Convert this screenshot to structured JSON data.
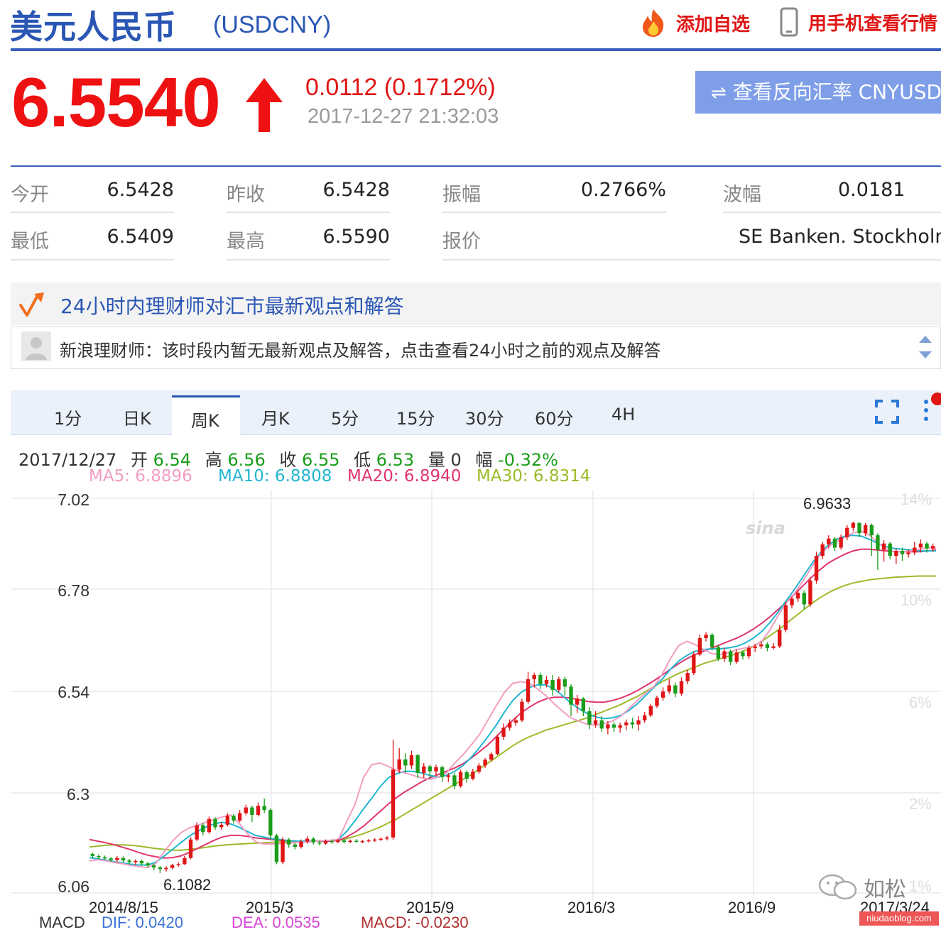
{
  "header": {
    "name_cn": "美元人民币",
    "symbol": "(USDCNY)",
    "add_watch": "添加自选",
    "mobile_view": "用手机查看行情"
  },
  "quote": {
    "price": "6.5540",
    "change": "0.0112 (0.1712%)",
    "timestamp": "2017-12-27 21:32:03",
    "reverse_button": "查看反向汇率 CNYUSD"
  },
  "stats": [
    {
      "label": "今开",
      "value": "6.5428"
    },
    {
      "label": "昨收",
      "value": "6.5428"
    },
    {
      "label": "振幅",
      "value": "0.2766%"
    },
    {
      "label": "波幅",
      "value": "0.0181"
    },
    {
      "label": "最低",
      "value": "6.5409"
    },
    {
      "label": "最高",
      "value": "6.5590"
    },
    {
      "label": "报价",
      "value": "SE Banken. Stockholm"
    }
  ],
  "advisor": {
    "title": "24小时内理财师对汇市最新观点和解答",
    "note": "新浪理财师：该时段内暂无最新观点及解答，点击查看24小时之前的观点及解答"
  },
  "tabs": [
    "1分",
    "日K",
    "周K",
    "月K",
    "5分",
    "15分",
    "30分",
    "60分",
    "4H"
  ],
  "active_tab": "周K",
  "ohlc": {
    "date": "2017/12/27",
    "open_label": "开",
    "open": "6.54",
    "high_label": "高",
    "high": "6.56",
    "close_label": "收",
    "close": "6.55",
    "low_label": "低",
    "low": "6.53",
    "vol_label": "量",
    "vol": "0",
    "amp_label": "幅",
    "amp": "-0.32%"
  },
  "ma": {
    "ma5": "MA5: 6.8896",
    "ma10": "MA10: 6.8808",
    "ma20": "MA20: 6.8940",
    "ma30": "MA30: 6.8314"
  },
  "macd": {
    "label": "MACD",
    "dif": "DIF: 0.0420",
    "dea": "DEA: 0.0535",
    "macd": "MACD: -0.0230"
  },
  "watermark": "如松",
  "site": "niudaoblog.com",
  "colors": {
    "up": "#e01515",
    "down": "#1a9d1a",
    "ma5": "#f19ec2",
    "ma10": "#21b6d0",
    "ma20": "#e0356e",
    "ma30": "#9bbb2a"
  },
  "chart_data": {
    "type": "candlestick",
    "y_ticks": [
      "7.02",
      "6.78",
      "6.54",
      "6.3",
      "6.06"
    ],
    "y_ticks_right": [
      "14%",
      "10%",
      "6%",
      "2%",
      "1%"
    ],
    "ylim": [
      6.06,
      7.02
    ],
    "x_ticks": [
      "2014/8/15",
      "2015/3",
      "2015/9",
      "2016/3",
      "2016/9",
      "2017/3/24"
    ],
    "annotations": {
      "max": "6.9633",
      "min": "6.1082"
    },
    "candles": [
      [
        6.155,
        6.15,
        6.158,
        6.145
      ],
      [
        6.15,
        6.147,
        6.154,
        6.142
      ],
      [
        6.147,
        6.144,
        6.151,
        6.14
      ],
      [
        6.144,
        6.14,
        6.148,
        6.136
      ],
      [
        6.14,
        6.145,
        6.15,
        6.135
      ],
      [
        6.145,
        6.139,
        6.149,
        6.134
      ],
      [
        6.139,
        6.135,
        6.143,
        6.13
      ],
      [
        6.135,
        6.138,
        6.142,
        6.128
      ],
      [
        6.138,
        6.132,
        6.141,
        6.126
      ],
      [
        6.132,
        6.127,
        6.136,
        6.121
      ],
      [
        6.127,
        6.122,
        6.131,
        6.115
      ],
      [
        6.122,
        6.118,
        6.126,
        6.108
      ],
      [
        6.118,
        6.121,
        6.125,
        6.112
      ],
      [
        6.121,
        6.128,
        6.131,
        6.118
      ],
      [
        6.128,
        6.13,
        6.134,
        6.124
      ],
      [
        6.13,
        6.145,
        6.15,
        6.128
      ],
      [
        6.145,
        6.19,
        6.196,
        6.142
      ],
      [
        6.19,
        6.225,
        6.232,
        6.186
      ],
      [
        6.225,
        6.208,
        6.23,
        6.2
      ],
      [
        6.208,
        6.24,
        6.246,
        6.204
      ],
      [
        6.24,
        6.22,
        6.244,
        6.214
      ],
      [
        6.22,
        6.226,
        6.232,
        6.214
      ],
      [
        6.226,
        6.248,
        6.254,
        6.222
      ],
      [
        6.248,
        6.236,
        6.252,
        6.228
      ],
      [
        6.236,
        6.254,
        6.262,
        6.232
      ],
      [
        6.254,
        6.268,
        6.275,
        6.249
      ],
      [
        6.268,
        6.25,
        6.272,
        6.232
      ],
      [
        6.25,
        6.272,
        6.28,
        6.246
      ],
      [
        6.272,
        6.262,
        6.29,
        6.254
      ],
      [
        6.262,
        6.2,
        6.266,
        6.19
      ],
      [
        6.2,
        6.135,
        6.204,
        6.13
      ],
      [
        6.135,
        6.19,
        6.196,
        6.13
      ],
      [
        6.19,
        6.178,
        6.194,
        6.17
      ],
      [
        6.178,
        6.172,
        6.182,
        6.166
      ],
      [
        6.172,
        6.185,
        6.19,
        6.168
      ],
      [
        6.185,
        6.192,
        6.198,
        6.18
      ],
      [
        6.192,
        6.183,
        6.196,
        6.178
      ],
      [
        6.183,
        6.18,
        6.187,
        6.176
      ],
      [
        6.18,
        6.186,
        6.19,
        6.177
      ],
      [
        6.186,
        6.184,
        6.19,
        6.18
      ],
      [
        6.184,
        6.188,
        6.192,
        6.181
      ],
      [
        6.188,
        6.184,
        6.191,
        6.18
      ],
      [
        6.184,
        6.187,
        6.19,
        6.181
      ],
      [
        6.187,
        6.185,
        6.191,
        6.182
      ],
      [
        6.185,
        6.186,
        6.189,
        6.181
      ],
      [
        6.186,
        6.188,
        6.191,
        6.183
      ],
      [
        6.188,
        6.19,
        6.193,
        6.184
      ],
      [
        6.19,
        6.192,
        6.195,
        6.186
      ],
      [
        6.192,
        6.195,
        6.198,
        6.188
      ],
      [
        6.195,
        6.36,
        6.433,
        6.19
      ],
      [
        6.36,
        6.385,
        6.412,
        6.352
      ],
      [
        6.385,
        6.37,
        6.4,
        6.352
      ],
      [
        6.37,
        6.395,
        6.406,
        6.362
      ],
      [
        6.395,
        6.352,
        6.398,
        6.34
      ],
      [
        6.352,
        6.368,
        6.376,
        6.34
      ],
      [
        6.368,
        6.356,
        6.372,
        6.338
      ],
      [
        6.356,
        6.366,
        6.372,
        6.346
      ],
      [
        6.366,
        6.342,
        6.37,
        6.33
      ],
      [
        6.342,
        6.346,
        6.352,
        6.33
      ],
      [
        6.346,
        6.32,
        6.352,
        6.312
      ],
      [
        6.32,
        6.354,
        6.36,
        6.316
      ],
      [
        6.354,
        6.338,
        6.358,
        6.328
      ],
      [
        6.338,
        6.355,
        6.362,
        6.334
      ],
      [
        6.355,
        6.37,
        6.376,
        6.35
      ],
      [
        6.37,
        6.384,
        6.388,
        6.364
      ],
      [
        6.384,
        6.398,
        6.402,
        6.38
      ],
      [
        6.398,
        6.44,
        6.446,
        6.395
      ],
      [
        6.44,
        6.462,
        6.472,
        6.432
      ],
      [
        6.462,
        6.474,
        6.482,
        6.455
      ],
      [
        6.474,
        6.48,
        6.488,
        6.466
      ],
      [
        6.48,
        6.525,
        6.532,
        6.476
      ],
      [
        6.525,
        6.58,
        6.598,
        6.52
      ],
      [
        6.58,
        6.59,
        6.596,
        6.56
      ],
      [
        6.59,
        6.568,
        6.596,
        6.556
      ],
      [
        6.568,
        6.578,
        6.588,
        6.56
      ],
      [
        6.578,
        6.554,
        6.59,
        6.54
      ],
      [
        6.554,
        6.58,
        6.586,
        6.548
      ],
      [
        6.58,
        6.562,
        6.586,
        6.54
      ],
      [
        6.562,
        6.518,
        6.568,
        6.49
      ],
      [
        6.518,
        6.533,
        6.542,
        6.498
      ],
      [
        6.533,
        6.502,
        6.536,
        6.49
      ],
      [
        6.502,
        6.47,
        6.512,
        6.458
      ],
      [
        6.47,
        6.48,
        6.502,
        6.462
      ],
      [
        6.48,
        6.46,
        6.49,
        6.452
      ],
      [
        6.46,
        6.47,
        6.478,
        6.446
      ],
      [
        6.47,
        6.462,
        6.476,
        6.452
      ],
      [
        6.462,
        6.468,
        6.474,
        6.45
      ],
      [
        6.468,
        6.475,
        6.482,
        6.456
      ],
      [
        6.475,
        6.47,
        6.486,
        6.46
      ],
      [
        6.47,
        6.48,
        6.49,
        6.455
      ],
      [
        6.48,
        6.492,
        6.5,
        6.474
      ],
      [
        6.492,
        6.515,
        6.52,
        6.488
      ],
      [
        6.515,
        6.535,
        6.54,
        6.51
      ],
      [
        6.535,
        6.55,
        6.56,
        6.528
      ],
      [
        6.55,
        6.565,
        6.58,
        6.544
      ],
      [
        6.565,
        6.545,
        6.572,
        6.536
      ],
      [
        6.545,
        6.575,
        6.584,
        6.54
      ],
      [
        6.575,
        6.595,
        6.602,
        6.568
      ],
      [
        6.595,
        6.64,
        6.648,
        6.59
      ],
      [
        6.64,
        6.68,
        6.688,
        6.636
      ],
      [
        6.68,
        6.688,
        6.694,
        6.672
      ],
      [
        6.688,
        6.658,
        6.692,
        6.65
      ],
      [
        6.658,
        6.63,
        6.664,
        6.624
      ],
      [
        6.63,
        6.648,
        6.656,
        6.622
      ],
      [
        6.648,
        6.622,
        6.652,
        6.614
      ],
      [
        6.622,
        6.645,
        6.652,
        6.618
      ],
      [
        6.645,
        6.636,
        6.65,
        6.628
      ],
      [
        6.636,
        6.656,
        6.662,
        6.63
      ],
      [
        6.656,
        6.66,
        6.666,
        6.646
      ],
      [
        6.66,
        6.665,
        6.672,
        6.654
      ],
      [
        6.665,
        6.656,
        6.67,
        6.648
      ],
      [
        6.656,
        6.66,
        6.668,
        6.652
      ],
      [
        6.66,
        6.7,
        6.712,
        6.656
      ],
      [
        6.7,
        6.76,
        6.768,
        6.694
      ],
      [
        6.76,
        6.776,
        6.782,
        6.752
      ],
      [
        6.776,
        6.79,
        6.796,
        6.768
      ],
      [
        6.79,
        6.762,
        6.796,
        6.75
      ],
      [
        6.762,
        6.82,
        6.828,
        6.756
      ],
      [
        6.82,
        6.88,
        6.89,
        6.812
      ],
      [
        6.88,
        6.908,
        6.914,
        6.872
      ],
      [
        6.908,
        6.922,
        6.93,
        6.898
      ],
      [
        6.922,
        6.9,
        6.926,
        6.892
      ],
      [
        6.9,
        6.925,
        6.932,
        6.895
      ],
      [
        6.925,
        6.948,
        6.955,
        6.918
      ],
      [
        6.948,
        6.96,
        6.9633,
        6.94
      ],
      [
        6.96,
        6.935,
        6.962,
        6.926
      ],
      [
        6.935,
        6.955,
        6.96,
        6.928
      ],
      [
        6.955,
        6.93,
        6.958,
        6.88
      ],
      [
        6.93,
        6.895,
        6.935,
        6.846
      ],
      [
        6.895,
        6.91,
        6.918,
        6.866
      ],
      [
        6.91,
        6.88,
        6.914,
        6.872
      ],
      [
        6.88,
        6.892,
        6.898,
        6.86
      ],
      [
        6.892,
        6.884,
        6.9,
        6.868
      ],
      [
        6.884,
        6.888,
        6.896,
        6.876
      ],
      [
        6.888,
        6.9,
        6.914,
        6.882
      ],
      [
        6.9,
        6.91,
        6.92,
        6.888
      ],
      [
        6.91,
        6.898,
        6.914,
        6.888
      ],
      [
        6.898,
        6.904,
        6.91,
        6.89
      ]
    ],
    "ma5": [
      6.138,
      6.141,
      6.138,
      6.134,
      6.131,
      6.127,
      6.124,
      6.122,
      6.132,
      6.16,
      6.186,
      6.206,
      6.218,
      6.224,
      6.232,
      6.238,
      6.245,
      6.25,
      6.23,
      6.205,
      6.185,
      6.179,
      6.179,
      6.18,
      6.181,
      6.183,
      6.184,
      6.185,
      6.187,
      6.188,
      6.19,
      6.234,
      6.276,
      6.34,
      6.372,
      6.376,
      6.368,
      6.358,
      6.352,
      6.346,
      6.34,
      6.336,
      6.342,
      6.352,
      6.376,
      6.396,
      6.42,
      6.446,
      6.48,
      6.515,
      6.548,
      6.57,
      6.574,
      6.57,
      6.556,
      6.54,
      6.52,
      6.502,
      6.486,
      6.478,
      6.47,
      6.468,
      6.472,
      6.478,
      6.49,
      6.508,
      6.528,
      6.546,
      6.562,
      6.592,
      6.63,
      6.662,
      6.672,
      6.664,
      6.652,
      6.642,
      6.64,
      6.644,
      6.652,
      6.656,
      6.66,
      6.672,
      6.7,
      6.736,
      6.766,
      6.79,
      6.82,
      6.852,
      6.882,
      6.902,
      6.914,
      6.925,
      6.936,
      6.94,
      6.93,
      6.912,
      6.896,
      6.89,
      6.89,
      6.892,
      6.896,
      6.9,
      6.898
    ],
    "ma10": [
      6.146,
      6.143,
      6.14,
      6.136,
      6.133,
      6.13,
      6.128,
      6.128,
      6.135,
      6.15,
      6.166,
      6.182,
      6.198,
      6.21,
      6.22,
      6.228,
      6.232,
      6.228,
      6.22,
      6.21,
      6.2,
      6.196,
      6.192,
      6.19,
      6.187,
      6.186,
      6.186,
      6.186,
      6.187,
      6.188,
      6.19,
      6.21,
      6.236,
      6.264,
      6.29,
      6.318,
      6.34,
      6.35,
      6.356,
      6.356,
      6.352,
      6.346,
      6.342,
      6.346,
      6.356,
      6.37,
      6.39,
      6.414,
      6.44,
      6.468,
      6.5,
      6.528,
      6.548,
      6.56,
      6.566,
      6.566,
      6.556,
      6.54,
      6.522,
      6.508,
      6.496,
      6.488,
      6.484,
      6.486,
      6.492,
      6.504,
      6.52,
      6.54,
      6.56,
      6.58,
      6.604,
      6.624,
      6.638,
      6.648,
      6.652,
      6.654,
      6.654,
      6.656,
      6.66,
      6.668,
      6.68,
      6.696,
      6.718,
      6.744,
      6.772,
      6.8,
      6.83,
      6.86,
      6.886,
      6.906,
      6.92,
      6.928,
      6.93,
      6.928,
      6.92,
      6.91,
      6.902,
      6.898,
      6.896,
      6.894,
      6.892,
      6.892,
      6.892
    ],
    "ma20": [
      6.19,
      6.186,
      6.182,
      6.177,
      6.171,
      6.165,
      6.158,
      6.152,
      6.148,
      6.145,
      6.146,
      6.15,
      6.158,
      6.168,
      6.178,
      6.188,
      6.196,
      6.2,
      6.2,
      6.198,
      6.194,
      6.192,
      6.19,
      6.188,
      6.187,
      6.186,
      6.186,
      6.186,
      6.186,
      6.186,
      6.188,
      6.196,
      6.208,
      6.222,
      6.24,
      6.258,
      6.276,
      6.292,
      6.306,
      6.318,
      6.33,
      6.34,
      6.348,
      6.356,
      6.364,
      6.374,
      6.388,
      6.404,
      6.42,
      6.44,
      6.46,
      6.48,
      6.498,
      6.512,
      6.524,
      6.532,
      6.536,
      6.536,
      6.534,
      6.53,
      6.526,
      6.524,
      6.524,
      6.528,
      6.534,
      6.542,
      6.552,
      6.564,
      6.576,
      6.59,
      6.604,
      6.618,
      6.63,
      6.64,
      6.648,
      6.656,
      6.664,
      6.672,
      6.68,
      6.69,
      6.702,
      6.716,
      6.732,
      6.75,
      6.768,
      6.788,
      6.808,
      6.828,
      6.846,
      6.862,
      6.874,
      6.884,
      6.892,
      6.896,
      6.896,
      6.894,
      6.892,
      6.89,
      6.89,
      6.89,
      6.89,
      6.892,
      6.894
    ],
    "ma30": [
      6.172,
      6.174,
      6.176,
      6.177,
      6.177,
      6.176,
      6.174,
      6.171,
      6.168,
      6.166,
      6.164,
      6.164,
      6.166,
      6.168,
      6.171,
      6.174,
      6.176,
      6.178,
      6.179,
      6.18,
      6.181,
      6.182,
      6.183,
      6.184,
      6.185,
      6.186,
      6.186,
      6.186,
      6.187,
      6.187,
      6.188,
      6.192,
      6.198,
      6.204,
      6.212,
      6.22,
      6.23,
      6.24,
      6.252,
      6.264,
      6.276,
      6.288,
      6.3,
      6.312,
      6.324,
      6.336,
      6.348,
      6.362,
      6.376,
      6.39,
      6.404,
      6.418,
      6.43,
      6.44,
      6.448,
      6.456,
      6.462,
      6.468,
      6.474,
      6.48,
      6.486,
      6.494,
      6.502,
      6.51,
      6.518,
      6.528,
      6.538,
      6.55,
      6.562,
      6.574,
      6.584,
      6.594,
      6.602,
      6.61,
      6.618,
      6.624,
      6.63,
      6.636,
      6.642,
      6.65,
      6.66,
      6.672,
      6.686,
      6.7,
      6.716,
      6.732,
      6.748,
      6.764,
      6.778,
      6.79,
      6.8,
      6.808,
      6.814,
      6.818,
      6.822,
      6.824,
      6.826,
      6.828,
      6.829,
      6.83,
      6.831,
      6.831,
      6.831
    ]
  }
}
